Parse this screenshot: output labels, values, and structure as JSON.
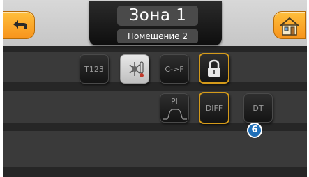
{
  "header": {
    "zone_title": "Зона 1",
    "room_name": "Помещение 2",
    "back_icon": "back-arrow-icon",
    "home_icon": "home-icon"
  },
  "tiles": {
    "t123": "T123",
    "heat_cool_icon": "heat-cool-icon",
    "c_to_f": "C->F",
    "lock_icon": "lock-icon",
    "pi": "PI",
    "diff": "DIFF",
    "dt": "DT"
  },
  "badge": {
    "value": "6"
  },
  "colors": {
    "accent_orange": "#f7941d",
    "active_border": "#d49a1a",
    "badge_blue": "#1f6fb8",
    "background": "#202020"
  }
}
